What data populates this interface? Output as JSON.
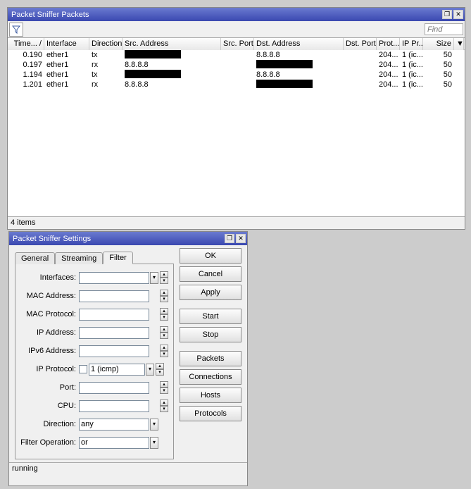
{
  "packets_window": {
    "title": "Packet Sniffer Packets",
    "find_placeholder": "Find",
    "columns": {
      "time": "Time... /",
      "interface": "Interface",
      "direction": "Direction",
      "src_addr": "Src. Address",
      "src_port": "Src. Port",
      "dst_addr": "Dst. Address",
      "dst_port": "Dst. Port",
      "protocol": "Prot...",
      "ip_protocol": "IP Pr...",
      "size": "Size"
    },
    "rows": [
      {
        "time": "0.190",
        "interface": "ether1",
        "direction": "tx",
        "src": "[redacted]",
        "src_port": "",
        "dst": "8.8.8.8",
        "dst_port": "",
        "protocol": "204...",
        "ip_protocol": "1 (ic...",
        "size": "50"
      },
      {
        "time": "0.197",
        "interface": "ether1",
        "direction": "rx",
        "src": "8.8.8.8",
        "src_port": "",
        "dst": "[redacted]",
        "dst_port": "",
        "protocol": "204...",
        "ip_protocol": "1 (ic...",
        "size": "50"
      },
      {
        "time": "1.194",
        "interface": "ether1",
        "direction": "tx",
        "src": "[redacted]",
        "src_port": "",
        "dst": "8.8.8.8",
        "dst_port": "",
        "protocol": "204...",
        "ip_protocol": "1 (ic...",
        "size": "50"
      },
      {
        "time": "1.201",
        "interface": "ether1",
        "direction": "rx",
        "src": "8.8.8.8",
        "src_port": "",
        "dst": "[redacted]",
        "dst_port": "",
        "protocol": "204...",
        "ip_protocol": "1 (ic...",
        "size": "50"
      }
    ],
    "status": "4 items"
  },
  "settings_window": {
    "title": "Packet Sniffer Settings",
    "tabs": {
      "general": "General",
      "streaming": "Streaming",
      "filter": "Filter"
    },
    "buttons": {
      "ok": "OK",
      "cancel": "Cancel",
      "apply": "Apply",
      "start": "Start",
      "stop": "Stop",
      "packets": "Packets",
      "connections": "Connections",
      "hosts": "Hosts",
      "protocols": "Protocols"
    },
    "labels": {
      "interfaces": "Interfaces:",
      "mac_address": "MAC Address:",
      "mac_protocol": "MAC Protocol:",
      "ip_address": "IP Address:",
      "ipv6_address": "IPv6 Address:",
      "ip_protocol": "IP Protocol:",
      "port": "Port:",
      "cpu": "CPU:",
      "direction": "Direction:",
      "filter_op": "Filter Operation:"
    },
    "values": {
      "interfaces": "",
      "mac_address": "",
      "mac_protocol": "",
      "ip_address": "",
      "ipv6_address": "",
      "ip_protocol": "1 (icmp)",
      "port": "",
      "cpu": "",
      "direction": "any",
      "filter_op": "or"
    },
    "status": "running"
  }
}
